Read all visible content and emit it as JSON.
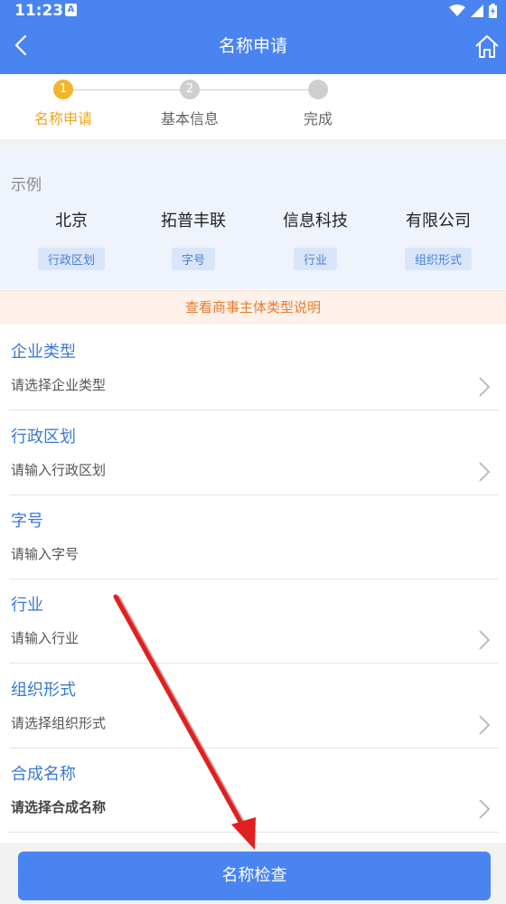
{
  "status": {
    "time": "11:23",
    "notif_letter": "A"
  },
  "header": {
    "title": "名称申请"
  },
  "stepper": {
    "steps": [
      {
        "number": "1",
        "label": "名称申请"
      },
      {
        "number": "2",
        "label": "基本信息"
      },
      {
        "number": "",
        "label": "完成"
      }
    ]
  },
  "example": {
    "title": "示例",
    "columns": [
      {
        "word": "北京",
        "tag": "行政区划"
      },
      {
        "word": "拓普丰联",
        "tag": "字号"
      },
      {
        "word": "信息科技",
        "tag": "行业"
      },
      {
        "word": "有限公司",
        "tag": "组织形式"
      }
    ]
  },
  "notice": "查看商事主体类型说明",
  "fields": [
    {
      "label": "企业类型",
      "value": "请选择企业类型"
    },
    {
      "label": "行政区划",
      "value": "请输入行政区划"
    },
    {
      "label": "字号",
      "value": "请输入字号"
    },
    {
      "label": "行业",
      "value": "请输入行业"
    },
    {
      "label": "组织形式",
      "value": "请选择组织形式"
    },
    {
      "label": "合成名称",
      "value": "请选择合成名称"
    }
  ],
  "bottom": {
    "check_label": "名称检查"
  },
  "colors": {
    "primary": "#4a84f0",
    "active_step": "#f0b52c",
    "notice_text": "#e97b2f",
    "arrow": "#e02020"
  }
}
